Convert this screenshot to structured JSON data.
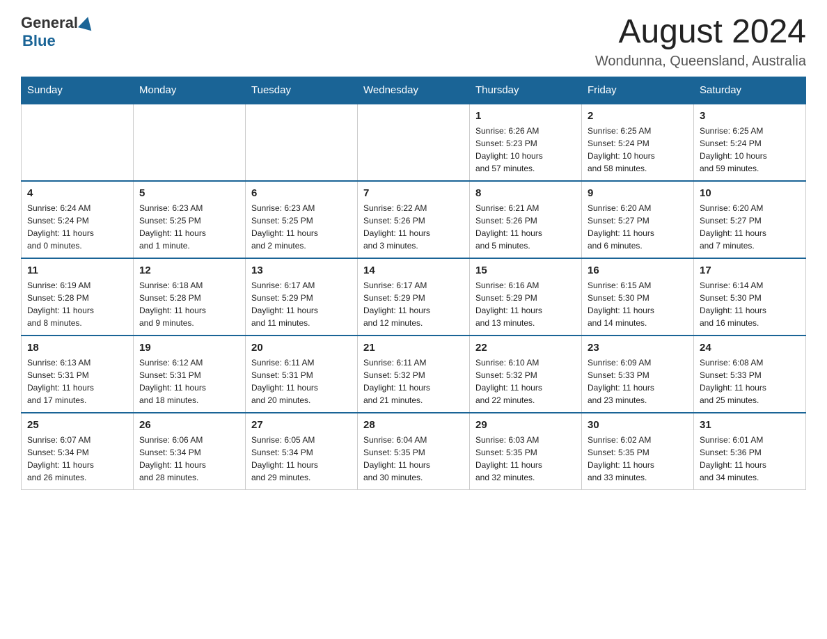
{
  "header": {
    "logo_general": "General",
    "logo_blue": "Blue",
    "month_title": "August 2024",
    "location": "Wondunna, Queensland, Australia"
  },
  "days_of_week": [
    "Sunday",
    "Monday",
    "Tuesday",
    "Wednesday",
    "Thursday",
    "Friday",
    "Saturday"
  ],
  "weeks": [
    {
      "cells": [
        {
          "day": "",
          "info": ""
        },
        {
          "day": "",
          "info": ""
        },
        {
          "day": "",
          "info": ""
        },
        {
          "day": "",
          "info": ""
        },
        {
          "day": "1",
          "info": "Sunrise: 6:26 AM\nSunset: 5:23 PM\nDaylight: 10 hours\nand 57 minutes."
        },
        {
          "day": "2",
          "info": "Sunrise: 6:25 AM\nSunset: 5:24 PM\nDaylight: 10 hours\nand 58 minutes."
        },
        {
          "day": "3",
          "info": "Sunrise: 6:25 AM\nSunset: 5:24 PM\nDaylight: 10 hours\nand 59 minutes."
        }
      ]
    },
    {
      "cells": [
        {
          "day": "4",
          "info": "Sunrise: 6:24 AM\nSunset: 5:24 PM\nDaylight: 11 hours\nand 0 minutes."
        },
        {
          "day": "5",
          "info": "Sunrise: 6:23 AM\nSunset: 5:25 PM\nDaylight: 11 hours\nand 1 minute."
        },
        {
          "day": "6",
          "info": "Sunrise: 6:23 AM\nSunset: 5:25 PM\nDaylight: 11 hours\nand 2 minutes."
        },
        {
          "day": "7",
          "info": "Sunrise: 6:22 AM\nSunset: 5:26 PM\nDaylight: 11 hours\nand 3 minutes."
        },
        {
          "day": "8",
          "info": "Sunrise: 6:21 AM\nSunset: 5:26 PM\nDaylight: 11 hours\nand 5 minutes."
        },
        {
          "day": "9",
          "info": "Sunrise: 6:20 AM\nSunset: 5:27 PM\nDaylight: 11 hours\nand 6 minutes."
        },
        {
          "day": "10",
          "info": "Sunrise: 6:20 AM\nSunset: 5:27 PM\nDaylight: 11 hours\nand 7 minutes."
        }
      ]
    },
    {
      "cells": [
        {
          "day": "11",
          "info": "Sunrise: 6:19 AM\nSunset: 5:28 PM\nDaylight: 11 hours\nand 8 minutes."
        },
        {
          "day": "12",
          "info": "Sunrise: 6:18 AM\nSunset: 5:28 PM\nDaylight: 11 hours\nand 9 minutes."
        },
        {
          "day": "13",
          "info": "Sunrise: 6:17 AM\nSunset: 5:29 PM\nDaylight: 11 hours\nand 11 minutes."
        },
        {
          "day": "14",
          "info": "Sunrise: 6:17 AM\nSunset: 5:29 PM\nDaylight: 11 hours\nand 12 minutes."
        },
        {
          "day": "15",
          "info": "Sunrise: 6:16 AM\nSunset: 5:29 PM\nDaylight: 11 hours\nand 13 minutes."
        },
        {
          "day": "16",
          "info": "Sunrise: 6:15 AM\nSunset: 5:30 PM\nDaylight: 11 hours\nand 14 minutes."
        },
        {
          "day": "17",
          "info": "Sunrise: 6:14 AM\nSunset: 5:30 PM\nDaylight: 11 hours\nand 16 minutes."
        }
      ]
    },
    {
      "cells": [
        {
          "day": "18",
          "info": "Sunrise: 6:13 AM\nSunset: 5:31 PM\nDaylight: 11 hours\nand 17 minutes."
        },
        {
          "day": "19",
          "info": "Sunrise: 6:12 AM\nSunset: 5:31 PM\nDaylight: 11 hours\nand 18 minutes."
        },
        {
          "day": "20",
          "info": "Sunrise: 6:11 AM\nSunset: 5:31 PM\nDaylight: 11 hours\nand 20 minutes."
        },
        {
          "day": "21",
          "info": "Sunrise: 6:11 AM\nSunset: 5:32 PM\nDaylight: 11 hours\nand 21 minutes."
        },
        {
          "day": "22",
          "info": "Sunrise: 6:10 AM\nSunset: 5:32 PM\nDaylight: 11 hours\nand 22 minutes."
        },
        {
          "day": "23",
          "info": "Sunrise: 6:09 AM\nSunset: 5:33 PM\nDaylight: 11 hours\nand 23 minutes."
        },
        {
          "day": "24",
          "info": "Sunrise: 6:08 AM\nSunset: 5:33 PM\nDaylight: 11 hours\nand 25 minutes."
        }
      ]
    },
    {
      "cells": [
        {
          "day": "25",
          "info": "Sunrise: 6:07 AM\nSunset: 5:34 PM\nDaylight: 11 hours\nand 26 minutes."
        },
        {
          "day": "26",
          "info": "Sunrise: 6:06 AM\nSunset: 5:34 PM\nDaylight: 11 hours\nand 28 minutes."
        },
        {
          "day": "27",
          "info": "Sunrise: 6:05 AM\nSunset: 5:34 PM\nDaylight: 11 hours\nand 29 minutes."
        },
        {
          "day": "28",
          "info": "Sunrise: 6:04 AM\nSunset: 5:35 PM\nDaylight: 11 hours\nand 30 minutes."
        },
        {
          "day": "29",
          "info": "Sunrise: 6:03 AM\nSunset: 5:35 PM\nDaylight: 11 hours\nand 32 minutes."
        },
        {
          "day": "30",
          "info": "Sunrise: 6:02 AM\nSunset: 5:35 PM\nDaylight: 11 hours\nand 33 minutes."
        },
        {
          "day": "31",
          "info": "Sunrise: 6:01 AM\nSunset: 5:36 PM\nDaylight: 11 hours\nand 34 minutes."
        }
      ]
    }
  ]
}
